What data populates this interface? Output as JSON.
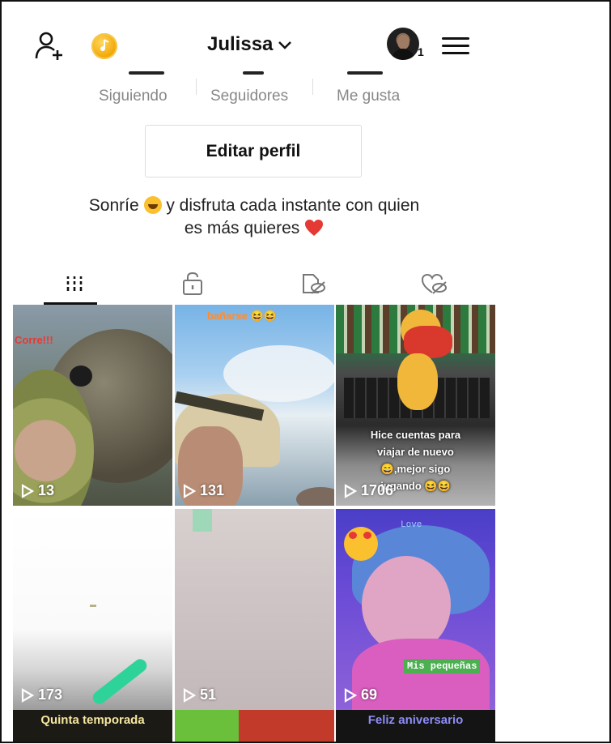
{
  "header": {
    "username": "Julissa",
    "notification_count": "1"
  },
  "stats": {
    "following_label": "Siguiendo",
    "followers_label": "Seguidores",
    "likes_label": "Me gusta"
  },
  "profile": {
    "edit_button": "Editar perfil",
    "bio_part1": "Sonríe",
    "bio_part2": "y disfruta cada instante con quien",
    "bio_part3": "es más quieres"
  },
  "tabs": [
    "videos-grid",
    "private",
    "liked-hidden",
    "favorites-hidden"
  ],
  "videos": [
    {
      "views": "13",
      "caption": "Corre!!!"
    },
    {
      "views": "131",
      "caption": "bañarse 😆😆"
    },
    {
      "views": "1706",
      "caption_lines": [
        "Hice cuentas para",
        "viajar de nuevo",
        "😄,mejor sigo",
        "jugando 😆😆"
      ]
    },
    {
      "views": "173",
      "caption": ""
    },
    {
      "views": "51",
      "caption": ""
    },
    {
      "views": "69",
      "caption": "Mis pequeñas",
      "caption_top": "Love"
    }
  ],
  "bottom_row": {
    "left": "Quinta temporada",
    "right": "Feliz aniversario"
  },
  "colors": {
    "accent_heart": "#e53935",
    "coin": "#f5b300",
    "caption_orange": "#ff8c2e",
    "caption_red": "#e53935",
    "green_tag": "#4caf50"
  }
}
